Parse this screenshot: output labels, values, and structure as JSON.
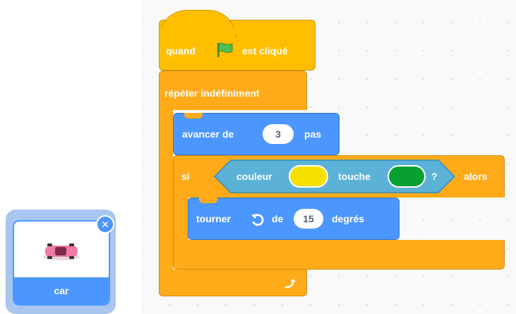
{
  "event_block": {
    "prefix": "quand",
    "icon": "green-flag-icon",
    "suffix": "est cliqué"
  },
  "forever_block": {
    "label": "répéter indéfiniment",
    "loop_icon": "loop-arrow-icon"
  },
  "move_block": {
    "prefix": "avancer de",
    "value": "3",
    "suffix": "pas"
  },
  "if_block": {
    "prefix": "si",
    "suffix": "alors"
  },
  "sensing_block": {
    "prefix": "couleur",
    "middle": "touche",
    "suffix": "?",
    "color_one": "#f6e000",
    "color_two": "#08a131"
  },
  "turn_block": {
    "prefix": "tourner",
    "icon": "rotate-left-icon",
    "middle": "de",
    "value": "15",
    "suffix": "degrés"
  },
  "sprite": {
    "name": "car",
    "delete_icon": "close-icon"
  },
  "colors": {
    "events": "#ffbf00",
    "control": "#ffab19",
    "motion": "#4c97ff",
    "sensing": "#5cb1d6",
    "flag": "#4cbf56"
  }
}
